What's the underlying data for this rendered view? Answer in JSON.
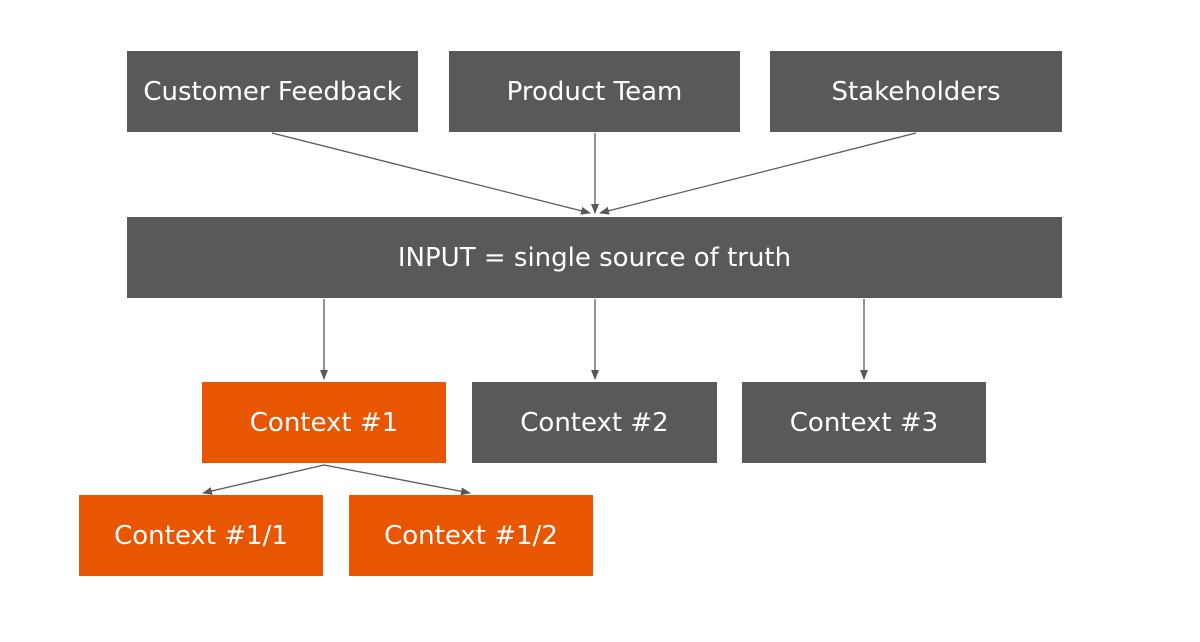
{
  "colors": {
    "node_gray": "#595959",
    "node_orange": "#e85602",
    "edge": "#595959"
  },
  "nodes": {
    "customer_feedback": {
      "label": "Customer Feedback"
    },
    "product_team": {
      "label": "Product Team"
    },
    "stakeholders": {
      "label": "Stakeholders"
    },
    "input": {
      "label": "INPUT = single source of truth"
    },
    "context_1": {
      "label": "Context #1"
    },
    "context_2": {
      "label": "Context #2"
    },
    "context_3": {
      "label": "Context #3"
    },
    "context_1_1": {
      "label": "Context #1/1"
    },
    "context_1_2": {
      "label": "Context #1/2"
    }
  },
  "edges": [
    {
      "from": "customer_feedback",
      "to": "input"
    },
    {
      "from": "product_team",
      "to": "input"
    },
    {
      "from": "stakeholders",
      "to": "input"
    },
    {
      "from": "input",
      "to": "context_1"
    },
    {
      "from": "input",
      "to": "context_2"
    },
    {
      "from": "input",
      "to": "context_3"
    },
    {
      "from": "context_1",
      "to": "context_1_1"
    },
    {
      "from": "context_1",
      "to": "context_1_2"
    }
  ]
}
